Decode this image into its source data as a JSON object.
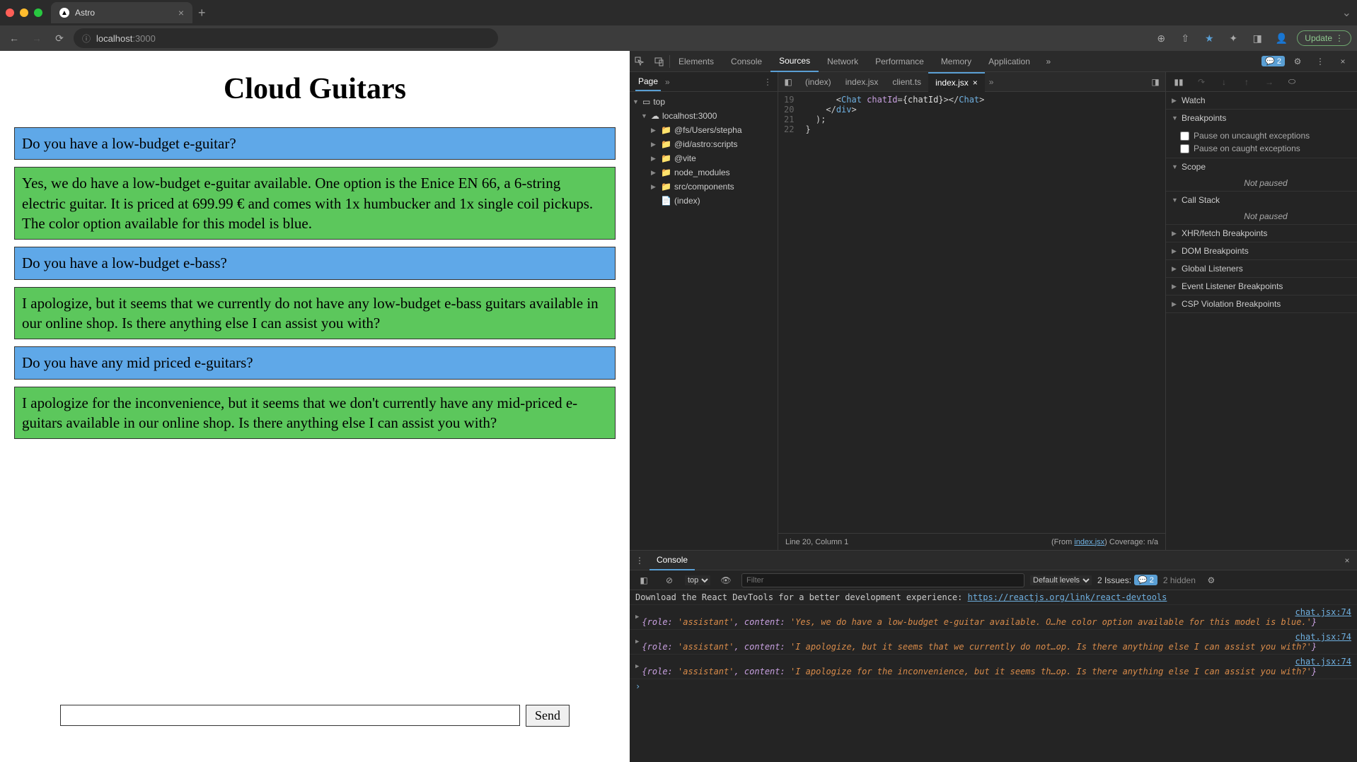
{
  "browser": {
    "tab_title": "Astro",
    "url_host": "localhost",
    "url_port": ":3000"
  },
  "page": {
    "title": "Cloud Guitars",
    "messages": [
      {
        "role": "user",
        "text": "Do you have a low-budget e-guitar?"
      },
      {
        "role": "assistant",
        "text": "Yes, we do have a low-budget e-guitar available. One option is the Enice EN 66, a 6-string electric guitar. It is priced at 699.99 € and comes with 1x humbucker and 1x single coil pickups. The color option available for this model is blue."
      },
      {
        "role": "user",
        "text": "Do you have a low-budget e-bass?"
      },
      {
        "role": "assistant",
        "text": "I apologize, but it seems that we currently do not have any low-budget e-bass guitars available in our online shop. Is there anything else I can assist you with?"
      },
      {
        "role": "user",
        "text": "Do you have any mid priced e-guitars?"
      },
      {
        "role": "assistant",
        "text": "I apologize for the inconvenience, but it seems that we don't currently have any mid-priced e-guitars available in our online shop. Is there anything else I can assist you with?"
      }
    ],
    "send_label": "Send"
  },
  "devtools": {
    "tabs": [
      "Elements",
      "Console",
      "Sources",
      "Network",
      "Performance",
      "Memory",
      "Application"
    ],
    "active_tab": "Sources",
    "errors_badge": "2",
    "file_nav": {
      "header": "Page",
      "tree": {
        "top": "top",
        "host": "localhost:3000",
        "items": [
          "@fs/Users/stepha",
          "@id/astro:scripts",
          "@vite",
          "node_modules",
          "src/components"
        ],
        "leaf": "(index)"
      }
    },
    "editor": {
      "tabs": [
        "(index)",
        "index.jsx",
        "client.ts",
        "index.jsx"
      ],
      "active_tab_index": 3,
      "gutter": [
        "19",
        "20",
        "21",
        "22"
      ],
      "status_left": "Line 20, Column 1",
      "status_from": "(From ",
      "status_from_link": "index.jsx",
      "status_from_close": ")",
      "coverage": "Coverage: n/a"
    },
    "debug": {
      "watch": "Watch",
      "breakpoints": "Breakpoints",
      "pause_uncaught": "Pause on uncaught exceptions",
      "pause_caught": "Pause on caught exceptions",
      "scope": "Scope",
      "not_paused": "Not paused",
      "callstack": "Call Stack",
      "xhr": "XHR/fetch Breakpoints",
      "dom": "DOM Breakpoints",
      "global": "Global Listeners",
      "event": "Event Listener Breakpoints",
      "csp": "CSP Violation Breakpoints"
    },
    "console": {
      "header": "Console",
      "context": "top",
      "filter_placeholder": "Filter",
      "levels": "Default levels",
      "issues_label": "2 Issues:",
      "issues_count": "2",
      "hidden": "2 hidden",
      "banner_text": "Download the React DevTools for a better development experience: ",
      "banner_link": "https://reactjs.org/link/react-devtools",
      "entries": [
        {
          "src": "chat.jsx:74",
          "text": "{role: 'assistant', content: 'Yes, we do have a low-budget e-guitar available. O…he color option available for this model is blue.'}"
        },
        {
          "src": "chat.jsx:74",
          "text": "{role: 'assistant', content: 'I apologize, but it seems that we currently do not…op. Is there anything else I can assist you with?'}"
        },
        {
          "src": "chat.jsx:74",
          "text": "{role: 'assistant', content: 'I apologize for the inconvenience, but it seems th…op. Is there anything else I can assist you with?'}"
        }
      ]
    }
  },
  "toolbar": {
    "update_label": "Update"
  }
}
